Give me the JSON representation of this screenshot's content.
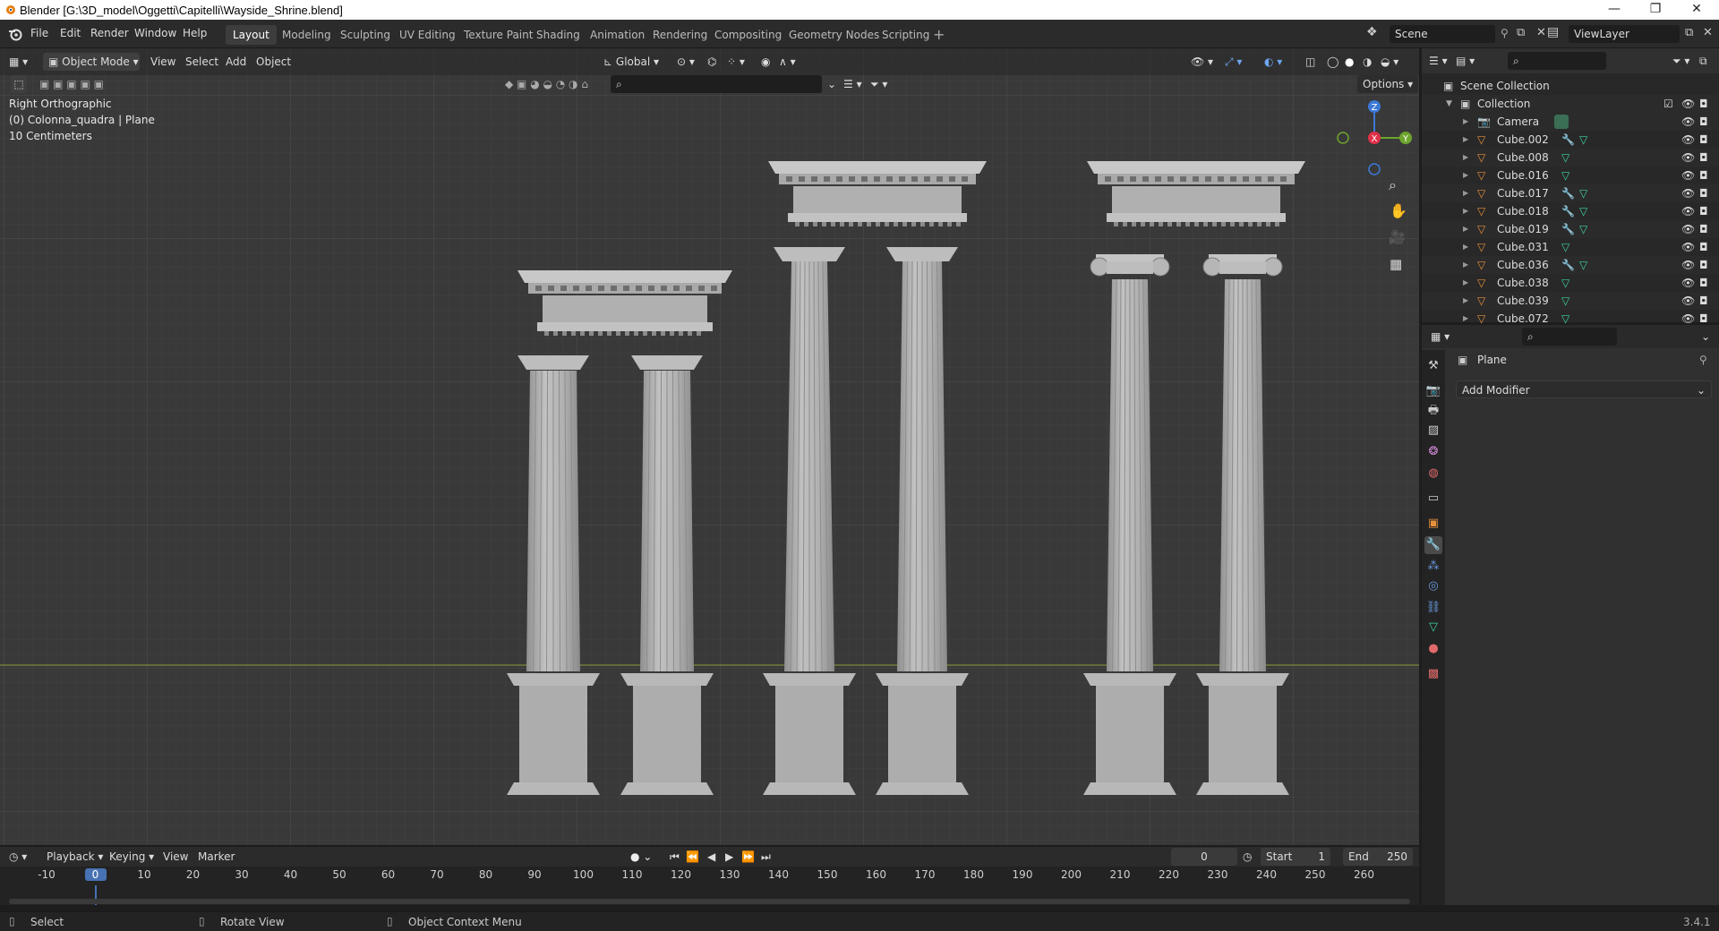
{
  "window": {
    "title": "Blender [G:\\3D_model\\Oggetti\\Capitelli\\Wayside_Shrine.blend]",
    "minimize_icon": "minimize-icon",
    "maximize_icon": "restore-icon",
    "close_icon": "close-icon"
  },
  "menus": [
    "File",
    "Edit",
    "Render",
    "Window",
    "Help"
  ],
  "workspaces": [
    "Layout",
    "Modeling",
    "Sculpting",
    "UV Editing",
    "Texture Paint",
    "Shading",
    "Animation",
    "Rendering",
    "Compositing",
    "Geometry Nodes",
    "Scripting"
  ],
  "active_workspace": "Layout",
  "scene": {
    "name": "Scene",
    "view_layer": "ViewLayer"
  },
  "viewport_header": {
    "mode": "Object Mode",
    "menus": [
      "View",
      "Select",
      "Add",
      "Object"
    ],
    "orientation": "Global",
    "options_label": "Options"
  },
  "hud": {
    "view_name": "Right Orthographic",
    "object_info": "(0) Colonna_quadra | Plane",
    "grid_scale": "10 Centimeters"
  },
  "gizmo": {
    "z": "Z",
    "x": "X",
    "y": "Y"
  },
  "outliner": {
    "root": "Scene Collection",
    "collection": "Collection",
    "items": [
      {
        "name": "Camera",
        "type": "camera",
        "mod": false
      },
      {
        "name": "Cube.002",
        "type": "mesh",
        "mod": true
      },
      {
        "name": "Cube.008",
        "type": "mesh",
        "mod": false
      },
      {
        "name": "Cube.016",
        "type": "mesh",
        "mod": false
      },
      {
        "name": "Cube.017",
        "type": "mesh",
        "mod": true
      },
      {
        "name": "Cube.018",
        "type": "mesh",
        "mod": true
      },
      {
        "name": "Cube.019",
        "type": "mesh",
        "mod": true
      },
      {
        "name": "Cube.031",
        "type": "mesh",
        "mod": false
      },
      {
        "name": "Cube.036",
        "type": "mesh",
        "mod": true
      },
      {
        "name": "Cube.038",
        "type": "mesh",
        "mod": false
      },
      {
        "name": "Cube.039",
        "type": "mesh",
        "mod": false
      },
      {
        "name": "Cube.072",
        "type": "mesh",
        "mod": false
      }
    ]
  },
  "properties": {
    "object_name": "Plane",
    "add_modifier_label": "Add Modifier"
  },
  "timeline": {
    "menus": [
      "Playback",
      "Keying",
      "View",
      "Marker"
    ],
    "current_frame": "0",
    "start_label": "Start",
    "start": "1",
    "end_label": "End",
    "end": "250",
    "ticks": [
      "-10",
      "0",
      "10",
      "20",
      "30",
      "40",
      "50",
      "60",
      "70",
      "80",
      "90",
      "100",
      "110",
      "120",
      "130",
      "140",
      "150",
      "160",
      "170",
      "180",
      "190",
      "200",
      "210",
      "220",
      "230",
      "240",
      "250",
      "260"
    ]
  },
  "statusbar": {
    "select": "Select",
    "rotate": "Rotate View",
    "context": "Object Context Menu",
    "version": "3.4.1"
  },
  "colors": {
    "accent": "#4772b3",
    "mesh_icon": "#e8913a",
    "modifier_icon": "#6b9be0",
    "data_icon": "#3fd49b",
    "horizon": "#7c8a3a",
    "column": "#b5b5b5"
  }
}
